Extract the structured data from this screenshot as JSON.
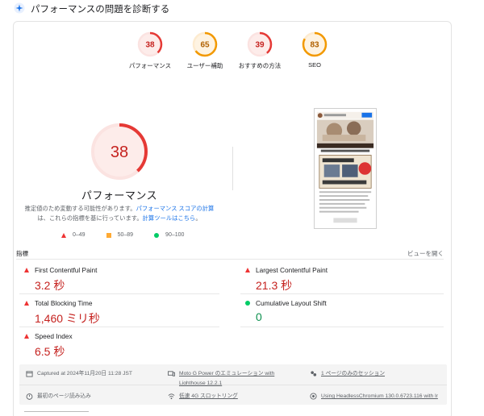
{
  "header": {
    "title": "パフォーマンスの問題を診断する",
    "icon": "sparkle-icon"
  },
  "categories": [
    {
      "score": "38",
      "label": "パフォーマンス",
      "color": "#e53935",
      "fraction": 0.38
    },
    {
      "score": "65",
      "label": "ユーザー補助",
      "color": "#f29900",
      "fraction": 0.65
    },
    {
      "score": "39",
      "label": "おすすめの方法",
      "color": "#e53935",
      "fraction": 0.39
    },
    {
      "score": "83",
      "label": "SEO",
      "color": "#f29900",
      "fraction": 0.83
    }
  ],
  "performance": {
    "score": "38",
    "fraction": 0.38,
    "label": "パフォーマンス",
    "desc_1": "推定値のため変動する可能性があります。",
    "desc_link_1": "パフォーマンス スコアの計算",
    "desc_2": "は、これらの指標を基に行っています。",
    "desc_link_2": "計算ツールはこちら",
    "desc_end": "。"
  },
  "legend": {
    "red": "0–49",
    "orange": "50–89",
    "green": "90–100"
  },
  "metrics_section": {
    "title": "指標",
    "expand": "ビューを開く"
  },
  "metrics": {
    "fcp": {
      "name": "First Contentful Paint",
      "value": "3.2 秒",
      "status": "bad"
    },
    "lcp": {
      "name": "Largest Contentful Paint",
      "value": "21.3 秒",
      "status": "bad"
    },
    "tbt": {
      "name": "Total Blocking Time",
      "value": "1,460 ミリ秒",
      "status": "bad"
    },
    "cls": {
      "name": "Cumulative Layout Shift",
      "value": "0",
      "status": "good"
    },
    "si": {
      "name": "Speed Index",
      "value": "6.5 秒",
      "status": "bad"
    }
  },
  "meta": {
    "captured": "Captured at 2024年11月20日 11:28 JST",
    "device_1": "Moto G Power のエミュレーション with",
    "device_2": "Lighthouse 12.2.1",
    "session": "1 ページのみのセッション",
    "load": "最初のページ読み込み",
    "network": "低速 4G スロットリング",
    "browser": "Using HeadlessChromium 130.0.6723.116 with lr"
  },
  "colors": {
    "red": "#e53935",
    "orange": "#f29900",
    "green": "#0cce6b",
    "link": "#1a73e8"
  }
}
